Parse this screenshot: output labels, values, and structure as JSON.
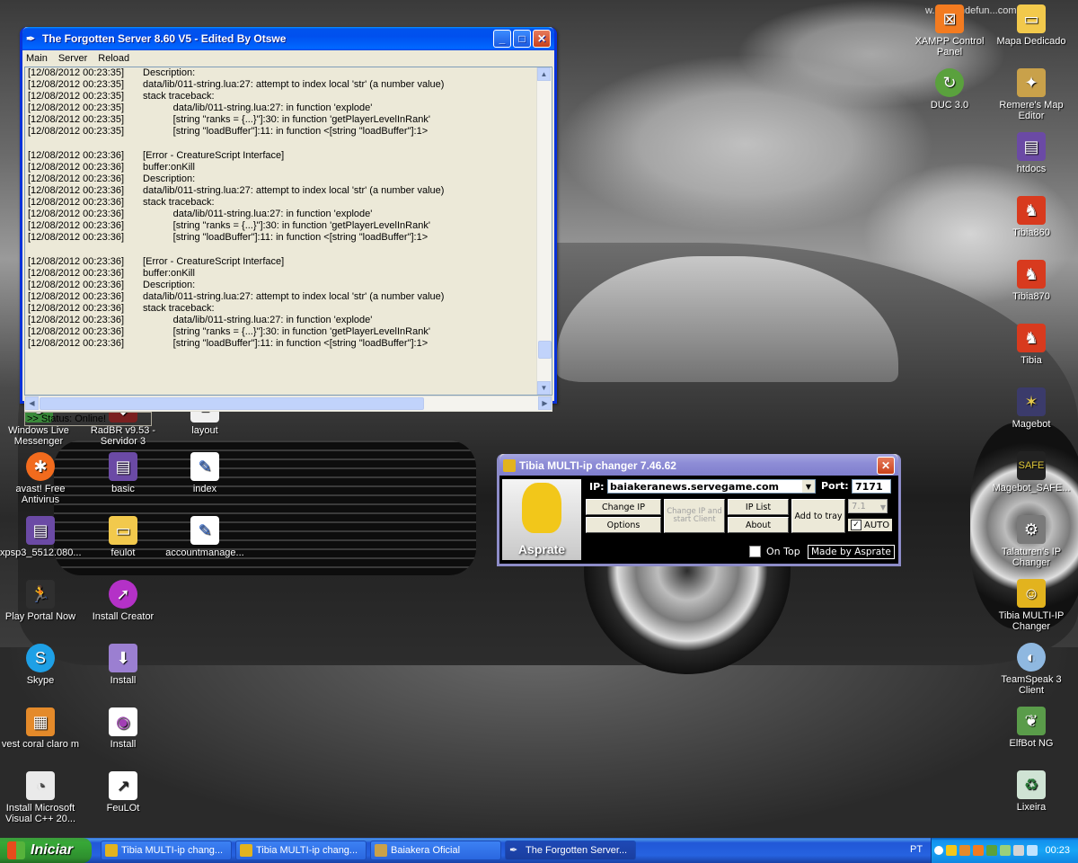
{
  "forgotten_server": {
    "title": "The Forgotten Server 8.60 V5 - Edited By Otswe",
    "menu": [
      "Main",
      "Server",
      "Reload"
    ],
    "log_lines": [
      {
        "ts": "[12/08/2012 00:23:35]",
        "msg": " Description:"
      },
      {
        "ts": "[12/08/2012 00:23:35]",
        "msg": " data/lib/011-string.lua:27: attempt to index local 'str' (a number value)"
      },
      {
        "ts": "[12/08/2012 00:23:35]",
        "msg": " stack traceback:"
      },
      {
        "ts": "[12/08/2012 00:23:35]",
        "msg": "            data/lib/011-string.lua:27: in function 'explode'"
      },
      {
        "ts": "[12/08/2012 00:23:35]",
        "msg": "            [string \"ranks = {...}\"]:30: in function 'getPlayerLevelInRank'"
      },
      {
        "ts": "[12/08/2012 00:23:35]",
        "msg": "            [string \"loadBuffer\"]:11: in function <[string \"loadBuffer\"]:1>"
      },
      {
        "ts": "",
        "msg": ""
      },
      {
        "ts": "[12/08/2012 00:23:36]",
        "msg": " [Error - CreatureScript Interface]"
      },
      {
        "ts": "[12/08/2012 00:23:36]",
        "msg": " buffer:onKill"
      },
      {
        "ts": "[12/08/2012 00:23:36]",
        "msg": " Description:"
      },
      {
        "ts": "[12/08/2012 00:23:36]",
        "msg": " data/lib/011-string.lua:27: attempt to index local 'str' (a number value)"
      },
      {
        "ts": "[12/08/2012 00:23:36]",
        "msg": " stack traceback:"
      },
      {
        "ts": "[12/08/2012 00:23:36]",
        "msg": "            data/lib/011-string.lua:27: in function 'explode'"
      },
      {
        "ts": "[12/08/2012 00:23:36]",
        "msg": "            [string \"ranks = {...}\"]:30: in function 'getPlayerLevelInRank'"
      },
      {
        "ts": "[12/08/2012 00:23:36]",
        "msg": "            [string \"loadBuffer\"]:11: in function <[string \"loadBuffer\"]:1>"
      },
      {
        "ts": "",
        "msg": ""
      },
      {
        "ts": "[12/08/2012 00:23:36]",
        "msg": " [Error - CreatureScript Interface]"
      },
      {
        "ts": "[12/08/2012 00:23:36]",
        "msg": " buffer:onKill"
      },
      {
        "ts": "[12/08/2012 00:23:36]",
        "msg": " Description:"
      },
      {
        "ts": "[12/08/2012 00:23:36]",
        "msg": " data/lib/011-string.lua:27: attempt to index local 'str' (a number value)"
      },
      {
        "ts": "[12/08/2012 00:23:36]",
        "msg": " stack traceback:"
      },
      {
        "ts": "[12/08/2012 00:23:36]",
        "msg": "            data/lib/011-string.lua:27: in function 'explode'"
      },
      {
        "ts": "[12/08/2012 00:23:36]",
        "msg": "            [string \"ranks = {...}\"]:30: in function 'getPlayerLevelInRank'"
      },
      {
        "ts": "[12/08/2012 00:23:36]",
        "msg": "            [string \"loadBuffer\"]:11: in function <[string \"loadBuffer\"]:1>"
      }
    ],
    "status": ">> Status: Online!"
  },
  "tibia_changer": {
    "title": "Tibia MULTI-ip changer 7.46.62",
    "ip_label": "IP:",
    "ip_value": "baiakeranews.servegame.com",
    "port_label": "Port:",
    "port_value": "7171",
    "btn_change_ip": "Change IP",
    "btn_options": "Options",
    "btn_change_start": "Change IP and start Client",
    "btn_ip_list": "IP List",
    "btn_about": "About",
    "btn_add_tray": "Add to tray",
    "version_select": "7.1",
    "auto_label": "AUTO",
    "on_top_label": "On Top",
    "made_by": "Made by Asprate",
    "logo_text": "Asprate"
  },
  "desktop_icons_left": [
    {
      "label": "Windows Live Messenger"
    },
    {
      "label": "RadBR v9.53 - Servidor 3"
    },
    {
      "label": "layout"
    },
    {
      "label": "avast! Free Antivirus"
    },
    {
      "label": "basic"
    },
    {
      "label": "index"
    },
    {
      "label": "xpsp3_5512.080..."
    },
    {
      "label": "feulot"
    },
    {
      "label": "accountmanage..."
    },
    {
      "label": "Play Portal Now"
    },
    {
      "label": "Install Creator"
    },
    {
      "label": "Skype"
    },
    {
      "label": "Install"
    },
    {
      "label": "vest coral claro m"
    },
    {
      "label": "Install"
    },
    {
      "label": "Install Microsoft Visual C++ 20..."
    },
    {
      "label": "FeuLOt"
    }
  ],
  "desktop_icons_right": [
    {
      "label": "XAMPP Control Panel"
    },
    {
      "label": "Mapa Dedicado"
    },
    {
      "label": "DUC 3.0"
    },
    {
      "label": "Remere's Map Editor"
    },
    {
      "label": "htdocs"
    },
    {
      "label": "Tibia860"
    },
    {
      "label": "Tibia870"
    },
    {
      "label": "Tibia"
    },
    {
      "label": "Magebot"
    },
    {
      "label": "Magebot_SAFE..."
    },
    {
      "label": "Talaturen's IP Changer"
    },
    {
      "label": "Tibia MULTI-IP Changer"
    },
    {
      "label": "TeamSpeak 3 Client"
    },
    {
      "label": "ElfBot NG"
    },
    {
      "label": "Lixeira"
    }
  ],
  "watermark": "w...agemdefun...com.br",
  "taskbar": {
    "start": "Iniciar",
    "items": [
      {
        "label": "Tibia MULTI-ip chang..."
      },
      {
        "label": "Tibia MULTI-ip chang..."
      },
      {
        "label": "Baiakera Oficial"
      },
      {
        "label": "The Forgotten Server..."
      }
    ],
    "lang": "PT",
    "clock": "00:23"
  }
}
